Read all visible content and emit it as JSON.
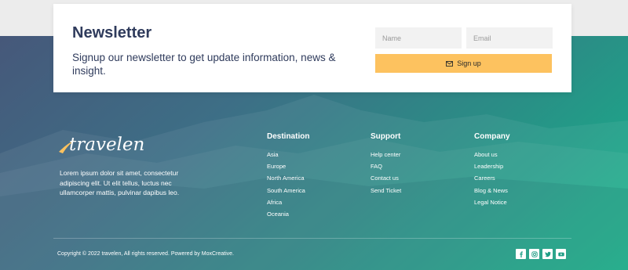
{
  "newsletter": {
    "title": "Newsletter",
    "subtitle": "Signup our newsletter to get update information, news & insight.",
    "name_placeholder": "Name",
    "email_placeholder": "Email",
    "button_label": "Sign up",
    "button_icon": "envelope-icon"
  },
  "brand": {
    "logo_text": "travelen",
    "description": "Lorem ipsum dolor sit amet, consectetur adipiscing elit. Ut elit tellus, luctus nec ullamcorper mattis, pulvinar dapibus leo."
  },
  "columns": {
    "destination": {
      "heading": "Destination",
      "items": [
        "Asia",
        "Europe",
        "North America",
        "South America",
        "Africa",
        "Oceania"
      ]
    },
    "support": {
      "heading": "Support",
      "items": [
        "Help center",
        "FAQ",
        "Contact us",
        "Send Ticket"
      ]
    },
    "company": {
      "heading": "Company",
      "items": [
        "About us",
        "Leadership",
        "Careers",
        "Blog & News",
        "Legal Notice"
      ]
    }
  },
  "footer": {
    "copyright": "Copyright © 2022 travelen, All rights reserved. Powered by MoxCreative."
  },
  "socials": {
    "facebook_icon": "facebook-icon",
    "instagram_icon": "instagram-icon",
    "twitter_icon": "twitter-icon",
    "youtube_icon": "youtube-icon"
  },
  "colors": {
    "accent": "#fdc25f",
    "heading": "#2f3b5c",
    "gradient_start": "#46587a",
    "gradient_end": "#14b58a"
  }
}
